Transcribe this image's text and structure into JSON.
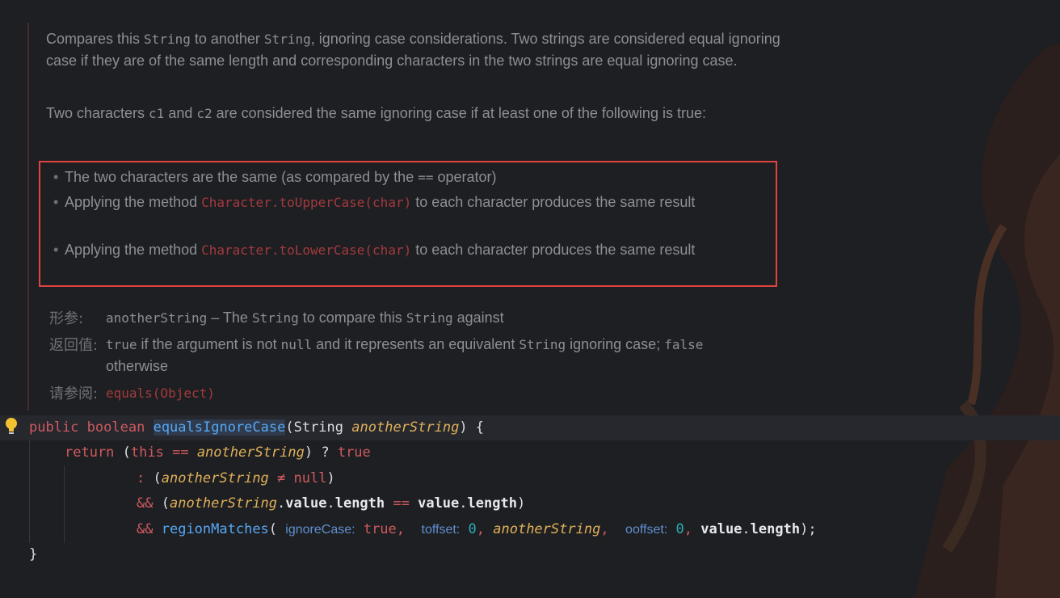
{
  "doc": {
    "para1": [
      {
        "t": "Compares this ",
        "c": false
      },
      {
        "t": "String",
        "c": true
      },
      {
        "t": " to another ",
        "c": false
      },
      {
        "t": "String",
        "c": true
      },
      {
        "t": ", ignoring case considerations. Two strings are considered equal ignoring case if they are of the same length and corresponding characters in the two strings are equal ignoring case.",
        "c": false
      }
    ],
    "para2": [
      {
        "t": "Two characters ",
        "c": false
      },
      {
        "t": "c1",
        "c": true
      },
      {
        "t": " and ",
        "c": false
      },
      {
        "t": "c2",
        "c": true
      },
      {
        "t": " are considered the same ignoring case if at least one of the following is true:",
        "c": false
      }
    ],
    "bullets": [
      [
        {
          "t": "The two characters are the same (as compared by the ",
          "c": false
        },
        {
          "t": "==",
          "c": true
        },
        {
          "t": " operator)",
          "c": false
        }
      ],
      [
        {
          "t": "Applying the method ",
          "c": false
        },
        {
          "t": "Character.toUpperCase(char)",
          "c": "link"
        },
        {
          "t": " to each character produces the same result",
          "c": false
        }
      ],
      [
        {
          "t": "Applying the method ",
          "c": false
        },
        {
          "t": "Character.toLowerCase(char)",
          "c": "link"
        },
        {
          "t": " to each character produces the same result",
          "c": false
        }
      ]
    ],
    "params_label": "形参:",
    "params": [
      {
        "t": "anotherString",
        "c": true
      },
      {
        "t": " – The ",
        "c": false
      },
      {
        "t": "String",
        "c": true
      },
      {
        "t": " to compare this ",
        "c": false
      },
      {
        "t": "String",
        "c": true
      },
      {
        "t": " against",
        "c": false
      }
    ],
    "returns_label": "返回值:",
    "returns": [
      {
        "t": "true",
        "c": true
      },
      {
        "t": " if the argument is not ",
        "c": false
      },
      {
        "t": "null",
        "c": true
      },
      {
        "t": " and it represents an equivalent ",
        "c": false
      },
      {
        "t": "String",
        "c": true
      },
      {
        "t": " ignoring case; ",
        "c": false
      },
      {
        "t": "false",
        "c": true
      },
      {
        "t": " otherwise",
        "c": false
      }
    ],
    "see_label": "请参阅:",
    "see_link": "equals(Object)"
  },
  "code": {
    "l1": {
      "public": "public",
      "boolean": "boolean",
      "method": "equalsIgnoreCase",
      "open": "(",
      "type": "String",
      "param": "anotherString",
      "close": ") {"
    },
    "l2": {
      "return": "return",
      "p1": " (",
      "this": "this",
      "op": " == ",
      "param": "anotherString",
      "p2": ") ? ",
      "true": "true"
    },
    "l3": {
      "colon": ": ",
      "p1": "(",
      "param": "anotherString",
      "op": " ≠ ",
      "null": "null",
      "p2": ")"
    },
    "l4": {
      "and": "&&",
      "p1": " (",
      "param": "anotherString",
      "dot1": ".",
      "value": "value",
      "dot2": ".",
      "length": "length",
      "op": " == ",
      "value2": "value",
      "dot3": ".",
      "length2": "length",
      "p2": ")"
    },
    "l5": {
      "and": "&&",
      "method": "regionMatches",
      "open": "(",
      "hint1": "ignoreCase:",
      "true": "true",
      "c1": ",",
      "hint2": "toffset:",
      "zero1": "0",
      "c2": ",",
      "param": "anotherString",
      "c3": ",",
      "hint3": "ooffset:",
      "zero2": "0",
      "c4": ",",
      "value": "value",
      "dot": ".",
      "length": "length",
      "close": ");"
    },
    "l6": {
      "brace": "}"
    }
  }
}
